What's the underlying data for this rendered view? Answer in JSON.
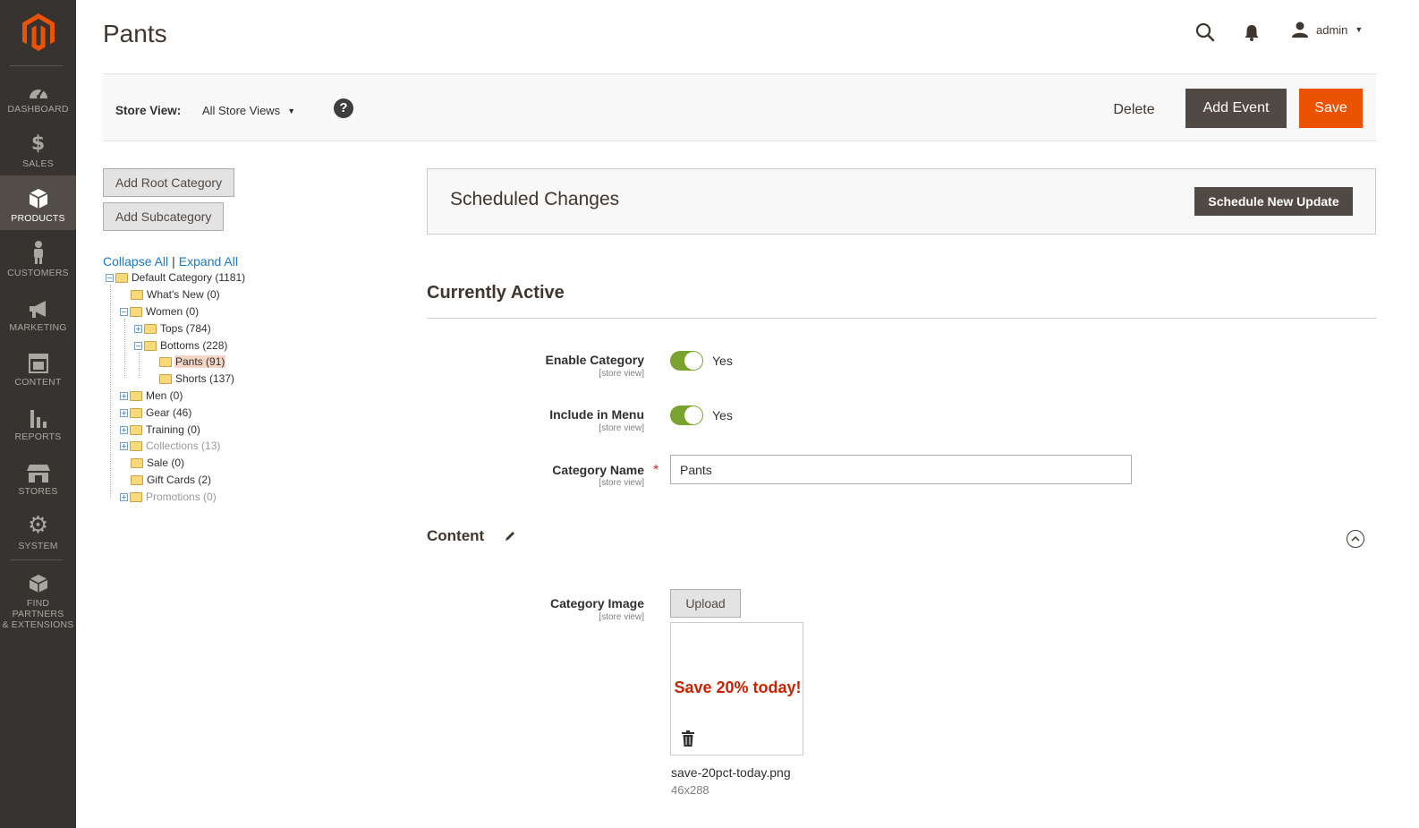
{
  "colors": {
    "sidebar_bg": "#373330",
    "accent": "#eb5202",
    "dark_button": "#514943",
    "toggle_on": "#79a22e",
    "link": "#1979c3"
  },
  "sidebar": {
    "items": [
      {
        "label": "DASHBOARD",
        "icon": "dashboard-icon"
      },
      {
        "label": "SALES",
        "icon": "dollar-icon"
      },
      {
        "label": "PRODUCTS",
        "icon": "box-icon",
        "active": true
      },
      {
        "label": "CUSTOMERS",
        "icon": "person-icon"
      },
      {
        "label": "MARKETING",
        "icon": "megaphone-icon"
      },
      {
        "label": "CONTENT",
        "icon": "layout-icon"
      },
      {
        "label": "REPORTS",
        "icon": "bar-chart-icon"
      },
      {
        "label": "STORES",
        "icon": "storefront-icon"
      },
      {
        "label": "SYSTEM",
        "icon": "gear-icon"
      },
      {
        "label_line1": "FIND PARTNERS",
        "label_line2": "& EXTENSIONS",
        "icon": "cubes-icon"
      }
    ]
  },
  "header": {
    "title": "Pants",
    "user": "admin"
  },
  "actionbar": {
    "store_view_label": "Store View:",
    "store_view_value": "All Store Views",
    "help": "?",
    "delete_label": "Delete",
    "add_event_label": "Add Event",
    "save_label": "Save"
  },
  "tree": {
    "add_root_label": "Add Root Category",
    "add_sub_label": "Add Subcategory",
    "collapse_all": "Collapse All",
    "separator": "|",
    "expand_all": "Expand All",
    "nodes": [
      {
        "label": "Default Category (1181)",
        "toggle": "⊟"
      },
      {
        "label": "What's New (0)"
      },
      {
        "label": "Women (0)",
        "toggle": "⊟"
      },
      {
        "label": "Tops (784)",
        "toggle": "⊞"
      },
      {
        "label": "Bottoms (228)",
        "toggle": "⊟"
      },
      {
        "label": "Pants (91)",
        "selected": true
      },
      {
        "label": "Shorts (137)"
      },
      {
        "label": "Men (0)",
        "toggle": "⊞"
      },
      {
        "label": "Gear (46)",
        "toggle": "⊞"
      },
      {
        "label": "Training (0)",
        "toggle": "⊞"
      },
      {
        "label": "Collections (13)",
        "toggle": "⊞",
        "muted": true
      },
      {
        "label": "Sale (0)"
      },
      {
        "label": "Gift Cards (2)"
      },
      {
        "label": "Promotions (0)",
        "toggle": "⊞",
        "muted": true
      }
    ]
  },
  "scheduled": {
    "title": "Scheduled Changes",
    "button": "Schedule New Update"
  },
  "active_section": {
    "title": "Currently Active"
  },
  "fields": {
    "enable_category": {
      "label": "Enable Category",
      "scope": "[store view]",
      "value": "Yes"
    },
    "include_in_menu": {
      "label": "Include in Menu",
      "scope": "[store view]",
      "value": "Yes"
    },
    "category_name": {
      "label": "Category Name",
      "scope": "[store view]",
      "value": "Pants",
      "required_mark": "*"
    }
  },
  "content_section": {
    "title": "Content",
    "image_label": "Category Image",
    "image_scope": "[store view]",
    "upload_label": "Upload",
    "image_preview_text": "Save 20% today!",
    "file_name": "save-20pct-today.png",
    "file_dims": "46x288"
  }
}
